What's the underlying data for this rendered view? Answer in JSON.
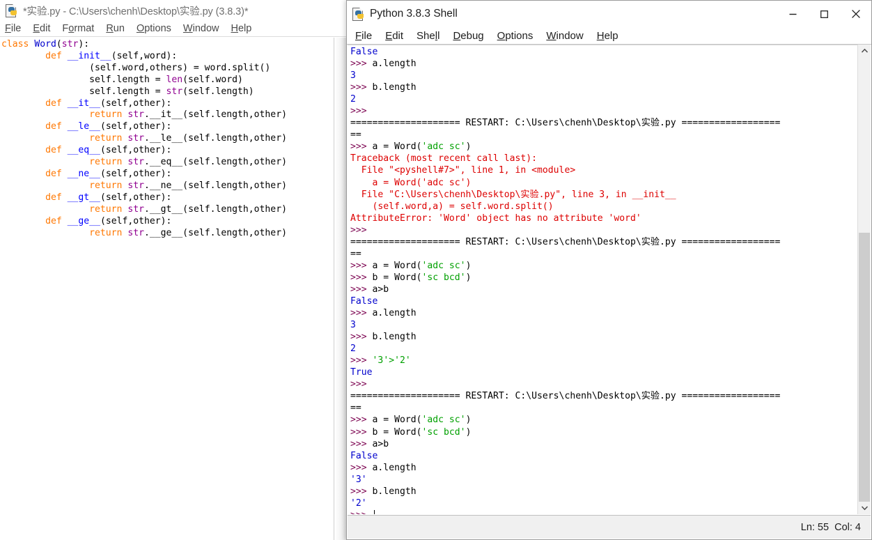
{
  "editor_window": {
    "title": "*实验.py - C:\\Users\\chenh\\Desktop\\实验.py (3.8.3)*",
    "icon": "python-idle-icon",
    "menu": [
      {
        "label": "File",
        "accel": "F"
      },
      {
        "label": "Edit",
        "accel": "E"
      },
      {
        "label": "Format",
        "accel": "o"
      },
      {
        "label": "Run",
        "accel": "R"
      },
      {
        "label": "Options",
        "accel": "O"
      },
      {
        "label": "Window",
        "accel": "W"
      },
      {
        "label": "Help",
        "accel": "H"
      }
    ],
    "code_lines": [
      "class Word(str):",
      "        def __init__(self,word):",
      "                (self.word,others) = word.split()",
      "                self.length = len(self.word)",
      "                self.length = str(self.length)",
      "        def __it__(self,other):",
      "                return str.__it__(self.length,other)",
      "        def __le__(self,other):",
      "                return str.__le__(self.length,other)",
      "        def __eq__(self,other):",
      "                return str.__eq__(self.length,other)",
      "        def __ne__(self,other):",
      "                return str.__ne__(self.length,other)",
      "        def __gt__(self,other):",
      "                return str.__gt__(self.length,other)",
      "        def __ge__(self,other):",
      "                return str.__ge__(self.length,other)"
    ]
  },
  "shell_window": {
    "title": "Python 3.8.3 Shell",
    "icon": "python-idle-icon",
    "controls": {
      "minimize": "minimize-icon",
      "maximize": "maximize-icon",
      "close": "close-icon"
    },
    "menu": [
      {
        "label": "File",
        "accel": "F"
      },
      {
        "label": "Edit",
        "accel": "E"
      },
      {
        "label": "Shell",
        "accel": "l"
      },
      {
        "label": "Debug",
        "accel": "D"
      },
      {
        "label": "Options",
        "accel": "O"
      },
      {
        "label": "Window",
        "accel": "W"
      },
      {
        "label": "Help",
        "accel": "H"
      }
    ],
    "restart_banner": "==================== RESTART: C:\\Users\\chenh\\Desktop\\实验.py ==================",
    "restart_banner_wrap": "==",
    "transcript": [
      {
        "type": "output",
        "text": "False"
      },
      {
        "type": "prompt",
        "text": ">>> a.length"
      },
      {
        "type": "output",
        "text": "3"
      },
      {
        "type": "prompt",
        "text": ">>> b.length"
      },
      {
        "type": "output",
        "text": "2"
      },
      {
        "type": "prompt",
        "text": ">>> "
      },
      {
        "type": "restart"
      },
      {
        "type": "prompt_str",
        "pre": ">>> a = Word(",
        "str": "'adc sc'",
        "post": ")"
      },
      {
        "type": "error",
        "text": "Traceback (most recent call last):"
      },
      {
        "type": "error",
        "text": "  File \"<pyshell#7>\", line 1, in <module>"
      },
      {
        "type": "error",
        "text": "    a = Word('adc sc')"
      },
      {
        "type": "error",
        "text": "  File \"C:\\Users\\chenh\\Desktop\\实验.py\", line 3, in __init__"
      },
      {
        "type": "error",
        "text": "    (self.word,a) = self.word.split()"
      },
      {
        "type": "error",
        "text": "AttributeError: 'Word' object has no attribute 'word'"
      },
      {
        "type": "prompt",
        "text": ">>> "
      },
      {
        "type": "restart"
      },
      {
        "type": "prompt_str",
        "pre": ">>> a = Word(",
        "str": "'adc sc'",
        "post": ")"
      },
      {
        "type": "prompt_str",
        "pre": ">>> b = Word(",
        "str": "'sc bcd'",
        "post": ")"
      },
      {
        "type": "prompt",
        "text": ">>> a>b"
      },
      {
        "type": "output",
        "text": "False"
      },
      {
        "type": "prompt",
        "text": ">>> a.length"
      },
      {
        "type": "output",
        "text": "3"
      },
      {
        "type": "prompt",
        "text": ">>> b.length"
      },
      {
        "type": "output",
        "text": "2"
      },
      {
        "type": "prompt_str",
        "pre": ">>> ",
        "str": "'3'>'2'",
        "post": ""
      },
      {
        "type": "output",
        "text": "True"
      },
      {
        "type": "prompt",
        "text": ">>> "
      },
      {
        "type": "restart"
      },
      {
        "type": "prompt_str",
        "pre": ">>> a = Word(",
        "str": "'adc sc'",
        "post": ")"
      },
      {
        "type": "prompt_str",
        "pre": ">>> b = Word(",
        "str": "'sc bcd'",
        "post": ")"
      },
      {
        "type": "prompt",
        "text": ">>> a>b"
      },
      {
        "type": "output",
        "text": "False"
      },
      {
        "type": "prompt",
        "text": ">>> a.length"
      },
      {
        "type": "output",
        "text": "'3'"
      },
      {
        "type": "prompt",
        "text": ">>> b.length"
      },
      {
        "type": "output",
        "text": "'2'"
      },
      {
        "type": "prompt_caret",
        "text": ">>> "
      }
    ],
    "status": "Ln: 55  Col: 4",
    "scrollbar": {
      "up_arrow": "chevron-up-icon",
      "down_arrow": "chevron-down-icon"
    }
  },
  "colors": {
    "keyword": "#ff7700",
    "classname": "#0000cd",
    "builtin": "#900090",
    "string": "#00a000",
    "error": "#dd0000",
    "prompt": "#7d0552",
    "stdout": "#0000cc"
  }
}
